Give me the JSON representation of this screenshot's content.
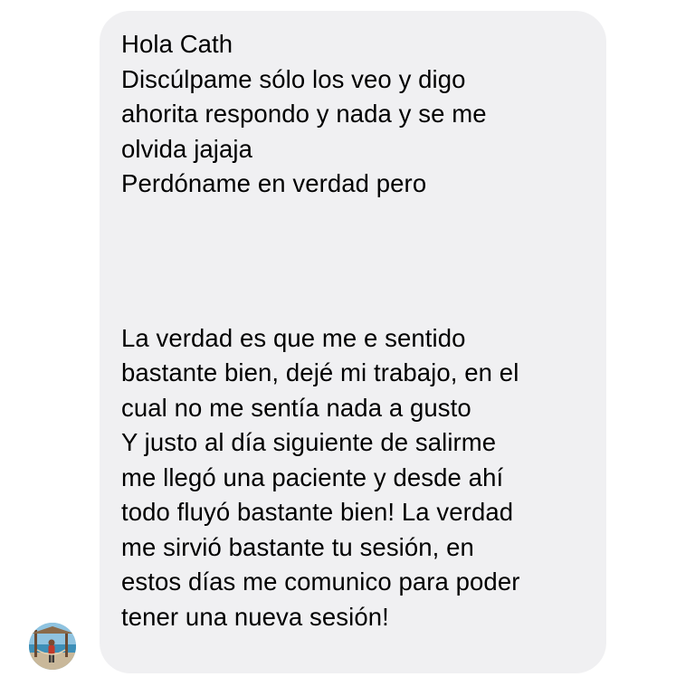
{
  "conversation": {
    "message": {
      "part1": [
        "Hola Cath",
        "Discúlpame sólo los veo y digo",
        "ahorita respondo y nada y se me",
        "olvida jajaja",
        "Perdóname en verdad pero"
      ],
      "part2": [
        "La verdad es que me e sentido",
        "bastante bien, dejé mi trabajo, en el",
        "cual no me sentía nada a gusto",
        "Y justo al día siguiente de salirme",
        "me llegó una paciente y desde ahí",
        "todo fluyó bastante bien! La verdad",
        "me sirvió bastante tu sesión, en",
        "estos días me comunico para poder",
        "tener una nueva sesión!"
      ]
    },
    "colors": {
      "bubble_background": "#f0f0f2",
      "text": "#000000",
      "page_background": "#ffffff"
    },
    "sender_avatar": {
      "icon": "profile-photo"
    }
  }
}
